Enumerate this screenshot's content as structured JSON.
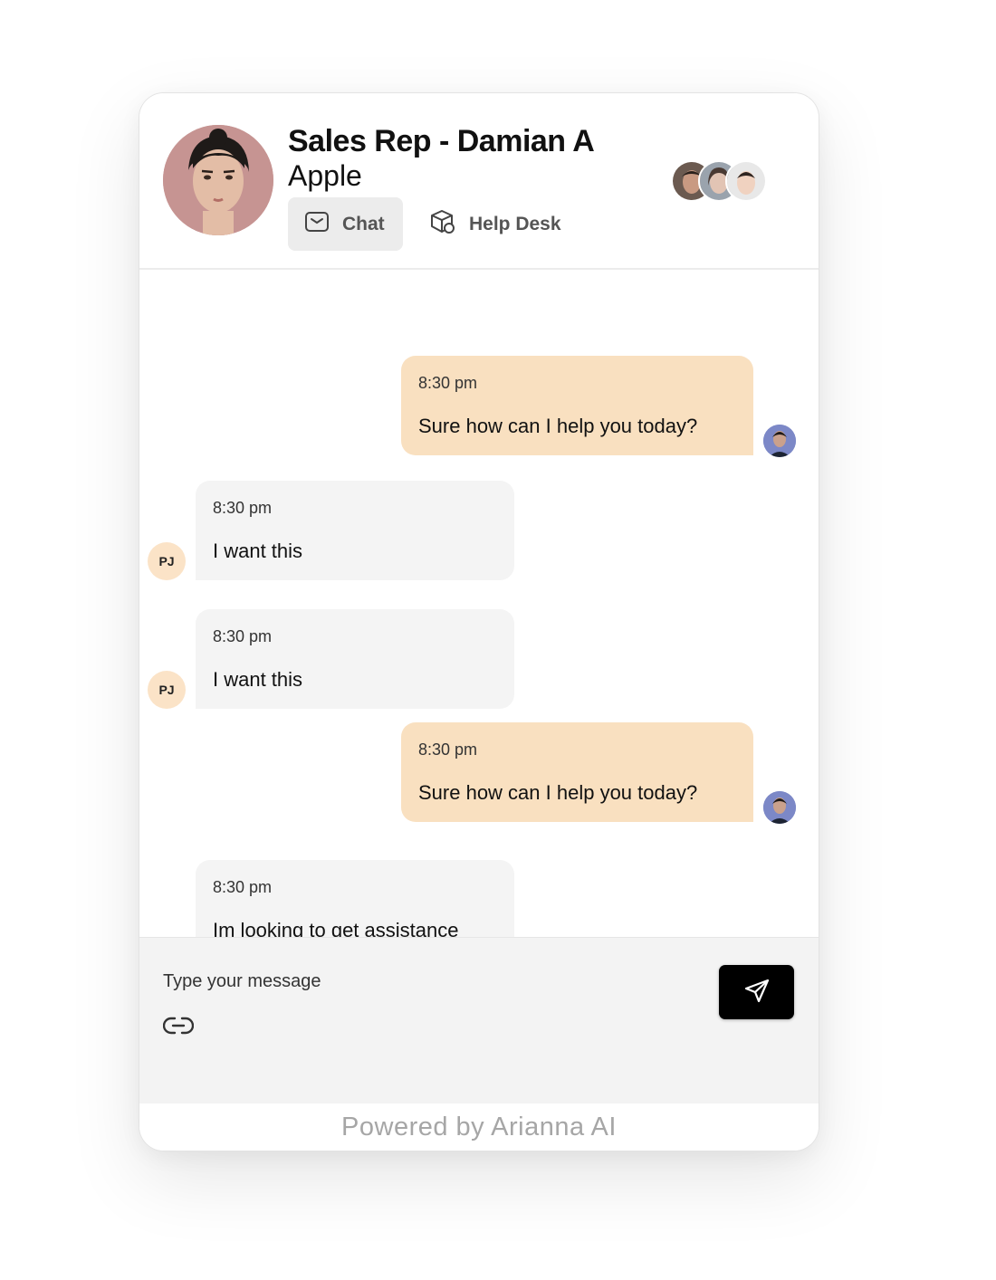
{
  "header": {
    "agent_name": "Sales Rep - Damian A",
    "company": "Apple",
    "tabs": [
      {
        "label": "Chat",
        "icon": "mail-icon",
        "active": true
      },
      {
        "label": "Help Desk",
        "icon": "box-icon",
        "active": false
      }
    ]
  },
  "messages": [
    {
      "sender": "agent",
      "time": "8:30 pm",
      "text": "Sure how can I help you today?"
    },
    {
      "sender": "user",
      "initials": "PJ",
      "time": "8:30 pm",
      "text": "I want this"
    },
    {
      "sender": "user",
      "initials": "PJ",
      "time": "8:30 pm",
      "text": "I want this"
    },
    {
      "sender": "agent",
      "time": "8:30 pm",
      "text": "Sure how can I help you today?"
    },
    {
      "sender": "user",
      "time": "8:30 pm",
      "text": "Im looking to get assistance"
    }
  ],
  "composer": {
    "placeholder": "Type your message",
    "attach_icon": "link-icon",
    "send_icon": "send-icon"
  },
  "footer": {
    "text": "Powered by Arianna AI"
  },
  "colors": {
    "agent_bubble": "#f9e0c0",
    "user_bubble": "#f4f4f4",
    "initials_badge": "#fbe3c7",
    "send_button": "#000000"
  }
}
